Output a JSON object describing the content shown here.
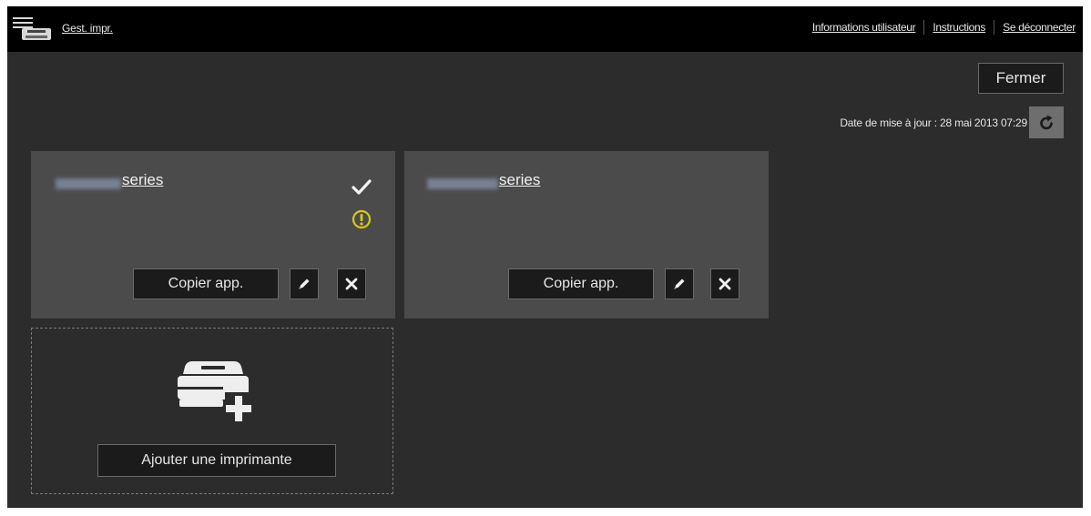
{
  "header": {
    "app_title": "Gest. impr.",
    "links": [
      "Informations utilisateur",
      "Instructions",
      "Se déconnecter"
    ]
  },
  "toolbar": {
    "close_label": "Fermer",
    "updated_text": "Date de mise à jour : 28 mai 2013 07:29"
  },
  "printers": [
    {
      "model_suffix": "series",
      "copy_label": "Copier app.",
      "status": [
        "check",
        "warning"
      ]
    },
    {
      "model_suffix": "series",
      "copy_label": "Copier app.",
      "status": []
    }
  ],
  "add_printer": {
    "label": "Ajouter une imprimante"
  },
  "colors": {
    "background": "#2c2c2c",
    "topbar": "#000000",
    "card": "#4b4b4b",
    "warning": "#d8c81a",
    "refresh_button": "#6e6e6e"
  }
}
